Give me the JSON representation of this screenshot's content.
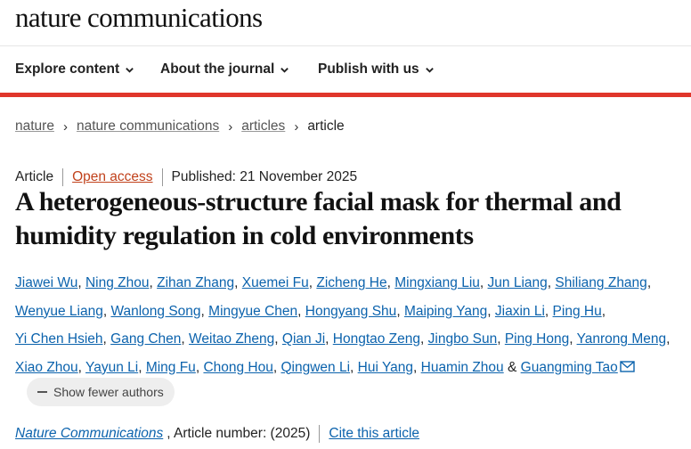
{
  "site": {
    "logo": "nature communications"
  },
  "nav": {
    "items": [
      {
        "label": "Explore content"
      },
      {
        "label": "About the journal"
      },
      {
        "label": "Publish with us"
      }
    ]
  },
  "breadcrumb": {
    "items": [
      "nature",
      "nature communications",
      "articles"
    ],
    "current": "article",
    "separator": "›"
  },
  "article": {
    "type": "Article",
    "access": "Open access",
    "published": "Published: 21 November 2025",
    "title": "A heterogeneous-structure facial mask for thermal and humidity regulation in cold environments",
    "authors": [
      "Jiawei Wu",
      "Ning Zhou",
      "Zihan Zhang",
      "Xuemei Fu",
      "Zicheng He",
      "Mingxiang Liu",
      "Jun Liang",
      "Shiliang Zhang",
      "Wenyue Liang",
      "Wanlong Song",
      "Mingyue Chen",
      "Hongyang Shu",
      "Maiping Yang",
      "Jiaxin Li",
      "Ping Hu",
      "Yi Chen Hsieh",
      "Gang Chen",
      "Weitao Zheng",
      "Qian Ji",
      "Hongtao Zeng",
      "Jingbo Sun",
      "Ping Hong",
      "Yanrong Meng",
      "Xiao Zhou",
      "Yayun Li",
      "Ming Fu",
      "Chong Hou",
      "Qingwen Li",
      "Hui Yang",
      "Huamin Zhou",
      "Guangming Tao"
    ],
    "last_joiner": "&",
    "show_fewer_label": "Show fewer authors",
    "journal": "Nature Communications",
    "article_number": ", Article number:  (2025)",
    "cite_label": "Cite this article"
  },
  "colors": {
    "accent_red": "#e0362b",
    "link_blue": "#0c63ad",
    "open_access": "#c1421c"
  },
  "icons": {
    "nav_chevron": "chevron-down-icon",
    "breadcrumb_separator": "chevron-right-icon",
    "email": "mail-icon",
    "collapse": "minus-icon"
  }
}
